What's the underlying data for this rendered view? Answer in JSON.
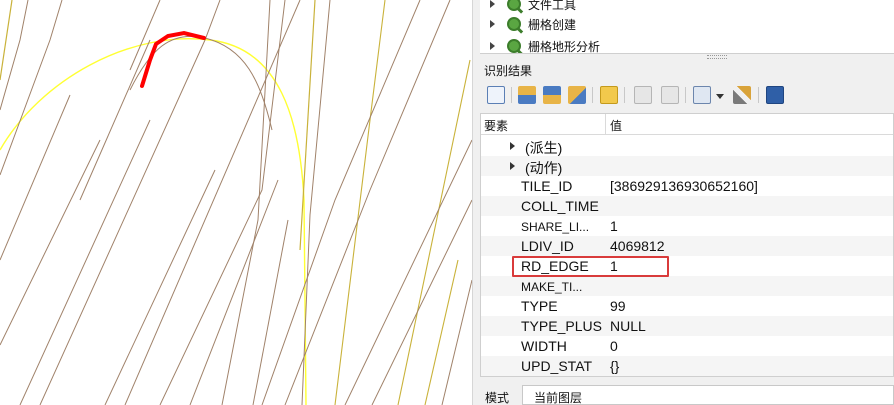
{
  "toolbox": {
    "items": [
      {
        "label": "文件工具"
      },
      {
        "label": "栅格创建"
      },
      {
        "label": "栅格地形分析"
      }
    ]
  },
  "panel": {
    "title": "识别结果",
    "toolbar": {
      "icons": [
        "expand-tree-icon",
        "expand-all-icon",
        "collapse-all-icon",
        "clear-results-icon",
        "copy-feature-icon",
        "print-icon",
        "identify-settings-icon",
        "settings-wrench-icon",
        "help-icon"
      ]
    },
    "columns": {
      "feature": "要素",
      "value": "值"
    },
    "groups": [
      {
        "label": "(派生)"
      },
      {
        "label": "(动作)"
      }
    ],
    "attributes": [
      {
        "field": "TILE_ID",
        "value": "[386929136930652160]"
      },
      {
        "field": "COLL_TIME",
        "value": ""
      },
      {
        "field": "SHARE_LI...",
        "value": "1"
      },
      {
        "field": "LDIV_ID",
        "value": "4069812"
      },
      {
        "field": "RD_EDGE",
        "value": "1"
      },
      {
        "field": "MAKE_TI...",
        "value": ""
      },
      {
        "field": "TYPE",
        "value": "99"
      },
      {
        "field": "TYPE_PLUS",
        "value": "NULL"
      },
      {
        "field": "WIDTH",
        "value": "0"
      },
      {
        "field": "UPD_STAT",
        "value": "{}"
      }
    ],
    "mode": {
      "label": "模式",
      "value": "当前图层"
    }
  },
  "colors": {
    "road_line": "#a0826a",
    "yellow_line": "#ffff33",
    "olive_line": "#c9b23a",
    "selected_feature": "#ff0000",
    "highlight_box": "#d93b3b",
    "qgis_green": "#5aa642"
  }
}
